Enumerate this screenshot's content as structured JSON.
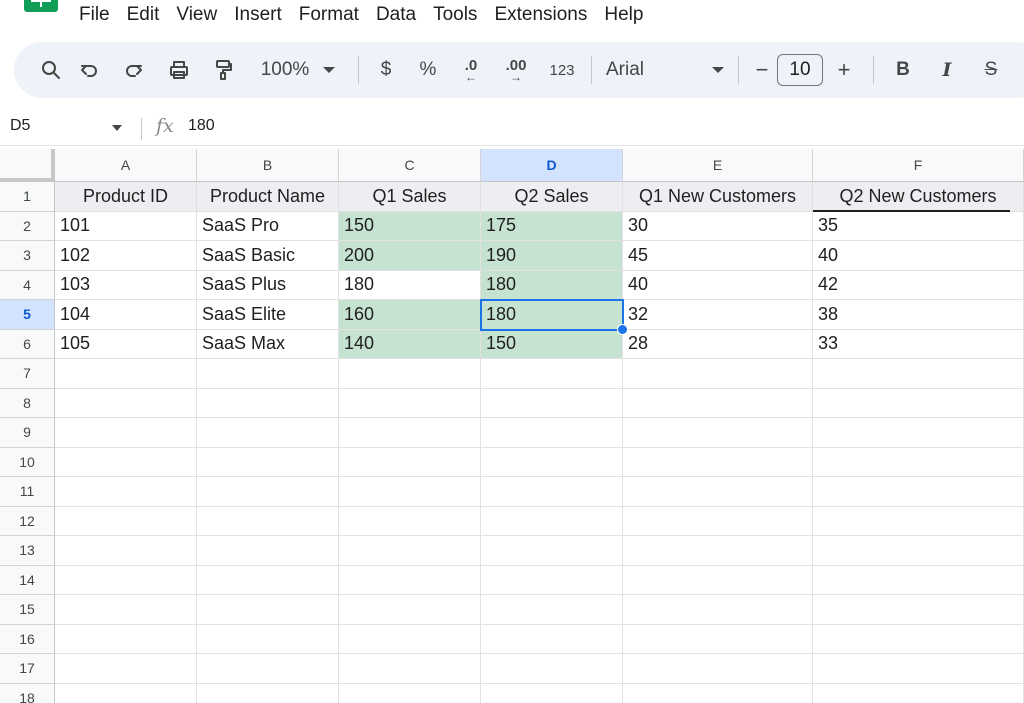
{
  "menu": {
    "items": [
      "File",
      "Edit",
      "View",
      "Insert",
      "Format",
      "Data",
      "Tools",
      "Extensions",
      "Help"
    ]
  },
  "toolbar": {
    "zoom": "100%",
    "currency": "$",
    "percent": "%",
    "decrease_decimal": ".0",
    "increase_decimal": ".00",
    "number_format": "123",
    "font": "Arial",
    "font_size": "10",
    "minus": "−",
    "plus": "+",
    "bold": "B",
    "italic": "I",
    "strike": "S"
  },
  "formula_bar": {
    "cell_ref": "D5",
    "fx": "fx",
    "value": "180"
  },
  "columns": [
    "A",
    "B",
    "C",
    "D",
    "E",
    "F"
  ],
  "rows": [
    "1",
    "2",
    "3",
    "4",
    "5",
    "6",
    "7",
    "8",
    "9",
    "10",
    "11",
    "12",
    "13",
    "14",
    "15",
    "16",
    "17",
    "18"
  ],
  "cells": [
    [
      "Product ID",
      "Product Name",
      "Q1 Sales",
      "Q2 Sales",
      "Q1 New Customers",
      "Q2 New Customers"
    ],
    [
      "101",
      "SaaS Pro",
      "150",
      "175",
      "30",
      "35"
    ],
    [
      "102",
      "SaaS Basic",
      "200",
      "190",
      "45",
      "40"
    ],
    [
      "103",
      "SaaS Plus",
      "180",
      "180",
      "40",
      "42"
    ],
    [
      "104",
      "SaaS Elite",
      "160",
      "180",
      "32",
      "38"
    ],
    [
      "105",
      "SaaS Max",
      "140",
      "150",
      "28",
      "33"
    ]
  ],
  "highlight_color": "#c6e3d2",
  "selection_color": "#1a73e8",
  "selected_cell": "D5"
}
